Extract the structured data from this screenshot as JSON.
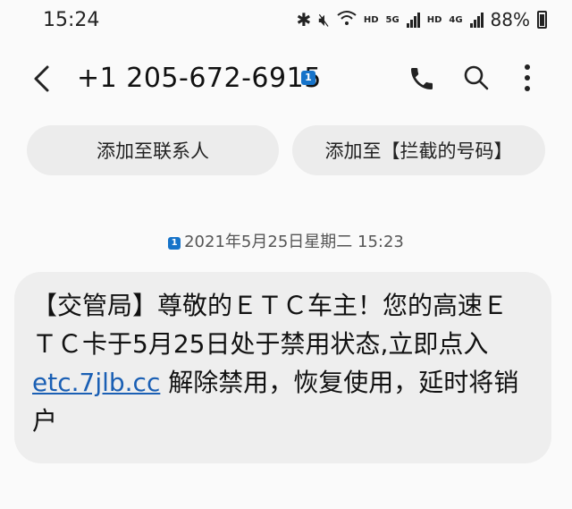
{
  "status_bar": {
    "time": "15:24",
    "hd1": "HD",
    "net1": "5G",
    "hd2": "HD",
    "net2": "4G",
    "battery": "88%"
  },
  "conversation": {
    "phone_number": "+1 205-672-6915",
    "sim_label": "1"
  },
  "chips": {
    "add_contact": "添加至联系人",
    "block_number": "添加至【拦截的号码】"
  },
  "message": {
    "sim_label": "1",
    "timestamp": "2021年5月25日星期二 15:23",
    "text_part1": "【交管局】尊敬的ＥＴＣ车主！您的高速ＥＴＣ卡于5月25日处于禁用状态,立即点入 ",
    "link": "etc.7jlb.cc",
    "text_part2": " 解除禁用，恢复使用，延时将销户"
  },
  "colors": {
    "accent": "#1673c9",
    "link": "#1a5fb4",
    "chip_bg": "#ececec",
    "bubble_bg": "#eeeeee"
  }
}
